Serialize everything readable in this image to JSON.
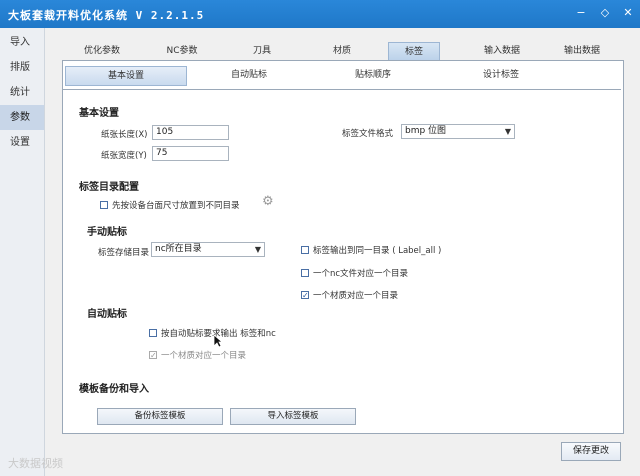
{
  "window": {
    "title": "大板套裁开料优化系统 V 2.2.1.5"
  },
  "sidebar": {
    "items": [
      {
        "label": "导入"
      },
      {
        "label": "排版"
      },
      {
        "label": "统计"
      },
      {
        "label": "参数",
        "active": true
      },
      {
        "label": "设置"
      }
    ]
  },
  "main_tabs": [
    "优化参数",
    "NC参数",
    "刀具",
    "材质",
    "标签",
    "输入数据",
    "输出数据"
  ],
  "main_tab_active": "标签",
  "sub_tabs": [
    "基本设置",
    "自动贴标",
    "贴标顺序",
    "设计标签"
  ],
  "sub_tab_active": "基本设置",
  "basic": {
    "title": "基本设置",
    "paper_length_label": "纸张长度(X)",
    "paper_length_value": "105",
    "paper_width_label": "纸张宽度(Y)",
    "paper_width_value": "75",
    "label_format_label": "标签文件格式",
    "label_format_value": "bmp 位图"
  },
  "label_dir": {
    "title": "标签目录配置",
    "by_size_check": "先按设备台面尺寸放置到不同目录",
    "by_size_checked": false
  },
  "manual": {
    "title": "手动贴标",
    "dir_label": "标签存储目录",
    "dir_value": "nc所在目录",
    "opt1": "标签输出到同一目录 ( Label_all )",
    "opt1_checked": false,
    "opt2": "一个nc文件对应一个目录",
    "opt2_checked": false,
    "opt3": "一个材质对应一个目录",
    "opt3_checked": true
  },
  "auto": {
    "title": "自动贴标",
    "opt1": "按自动贴标要求输出 标签和nc",
    "opt1_checked": false,
    "opt2": "一个材质对应一个目录",
    "opt2_checked": true
  },
  "template": {
    "title": "模板备份和导入",
    "backup_button": "备份标签模板",
    "import_button": "导入标签模板"
  },
  "footer": {
    "save_button": "保存更改"
  },
  "watermark": "大数据视频"
}
